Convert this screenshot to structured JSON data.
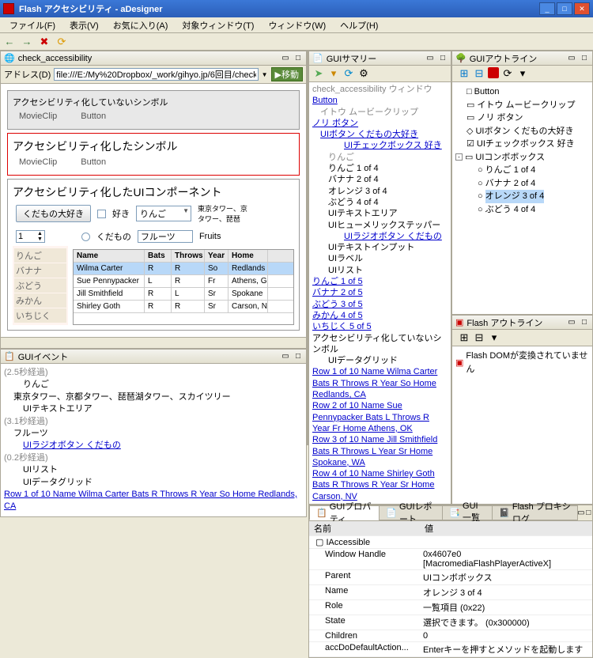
{
  "window": {
    "title": "Flash アクセシビリティ - aDesigner"
  },
  "menu": {
    "file": "ファイル(F)",
    "view": "表示(V)",
    "favorites": "お気に入り(A)",
    "targetWindow": "対象ウィンドウ(T)",
    "windows": "ウィンドウ(W)",
    "help": "ヘルプ(H)"
  },
  "toolbar": {
    "back": "←",
    "forward": "→",
    "stop": "✖",
    "refresh": "⟳"
  },
  "browser": {
    "panel_title": "check_accessibility",
    "address_label": "アドレス(D)",
    "url": "file:///E:/My%20Dropbox/_work/gihyo.jp/6回目/check_accessibility.html",
    "go_label": "移動"
  },
  "flash": {
    "box1_title": "アクセシビリティ化していないシンボル",
    "box2_title": "アクセシビリティ化したシンボル",
    "box3_title": "アクセシビリティ化したUIコンポーネント",
    "movieclip": "MovieClip",
    "button": "Button",
    "favorite_label": "くだもの大好き",
    "like_label": "好き",
    "combo_value": "りんご",
    "rhs_text": "東京タワー、京\nタワー、琵琶",
    "stepper_value": "1",
    "radio_label": "くだもの",
    "text_input": "フルーツ",
    "text_label": "Fruits",
    "side_items": [
      "りんご",
      "バナナ",
      "ぶどう",
      "みかん",
      "いちじく"
    ],
    "headers": [
      "Name",
      "Bats",
      "Throws",
      "Year",
      "Home"
    ],
    "rows": [
      [
        "Wilma Carter",
        "R",
        "R",
        "So",
        "Redlands"
      ],
      [
        "Sue Pennypacker",
        "L",
        "R",
        "Fr",
        "Athens, G"
      ],
      [
        "Jill Smithfield",
        "R",
        "L",
        "Sr",
        "Spokane"
      ],
      [
        "Shirley Goth",
        "R",
        "R",
        "Sr",
        "Carson, N"
      ]
    ]
  },
  "summary": {
    "title": "GUIサマリー",
    "root": "check_accessibility ウィンドウ",
    "items": [
      {
        "t": "Button",
        "link": true
      },
      {
        "t": "イトウ ムービークリップ",
        "gray": true,
        "indent": 1
      },
      {
        "t": "ノリ ボタン",
        "link": true
      },
      {
        "t": "UIボタン くだもの大好き",
        "link": true,
        "indent": 1
      },
      {
        "t": "UIチェックボックス 好き",
        "link": true,
        "indent": 4
      },
      {
        "t": "りんご",
        "gray": true,
        "indent": 2
      },
      {
        "t": "りんご 1 of 4",
        "indent": 2
      },
      {
        "t": "バナナ 2 of 4",
        "indent": 2
      },
      {
        "t": "オレンジ 3 of 4",
        "indent": 2
      },
      {
        "t": "ぶどう 4 of 4",
        "indent": 2
      },
      {
        "t": "UIテキストエリア",
        "indent": 2
      },
      {
        "t": "UIヒューメリックステッパー",
        "indent": 2
      },
      {
        "t": "UIラジオボタン くだもの",
        "link": true,
        "indent": 4
      },
      {
        "t": "UIテキストインプット",
        "indent": 2
      },
      {
        "t": "UIラベル",
        "indent": 2
      },
      {
        "t": "UIリスト",
        "indent": 2
      },
      {
        "t": "りんご 1 of 5",
        "link": true
      },
      {
        "t": "バナナ 2 of 5",
        "link": true
      },
      {
        "t": "ぶどう 3 of 5",
        "link": true
      },
      {
        "t": "みかん 4 of 5",
        "link": true
      },
      {
        "t": "いちじく 5 of 5",
        "link": true
      },
      {
        "t": "アクセシビリティ化していないシンボル"
      },
      {
        "t": "UIデータグリッド",
        "indent": 2
      },
      {
        "t": "Row 1 of 10 Name Wilma Carter Bats R Throws R Year So Home Redlands, CA",
        "link": true
      },
      {
        "t": "Row 2 of 10 Name Sue Pennypacker Bats L Throws R Year Fr Home Athens, OK",
        "link": true
      },
      {
        "t": "Row 3 of 10 Name Jill Smithfield Bats R Throws L Year Sr Home Spokane, WA",
        "link": true
      },
      {
        "t": "Row 4 of 10 Name Shirley Goth Bats R Throws R Year Sr Home Carson, NV",
        "link": true
      }
    ]
  },
  "outline": {
    "title": "GUIアウトライン",
    "items": [
      {
        "icon": "□",
        "label": "Button"
      },
      {
        "icon": "▭",
        "label": "イトウ ムービークリップ"
      },
      {
        "icon": "▭",
        "label": "ノリ ボタン"
      },
      {
        "icon": "◇",
        "label": "UIボタン くだもの大好き"
      },
      {
        "icon": "☑",
        "label": "UIチェックボックス 好き"
      },
      {
        "icon": "▭",
        "label": "UIコンボボックス",
        "expand": "-",
        "children": [
          {
            "icon": "○",
            "label": "りんご 1 of 4"
          },
          {
            "icon": "○",
            "label": "バナナ 2 of 4"
          },
          {
            "icon": "○",
            "label": "オレンジ 3 of 4",
            "sel": true
          },
          {
            "icon": "○",
            "label": "ぶどう 4 of 4"
          }
        ]
      }
    ]
  },
  "flash_outline": {
    "title": "Flash アウトライン",
    "msg": "Flash DOMが変換されていません"
  },
  "events": {
    "title": "GUIイベント",
    "lines": [
      {
        "t": "(2.5秒経過)",
        "gray": true
      },
      {
        "t": "りんご",
        "indent": 2
      },
      {
        "t": "東京タワー、京都タワー、琵琶湖タワー、スカイツリー",
        "indent": 1
      },
      {
        "t": "UIテキストエリア",
        "indent": 2
      },
      {
        "t": "(3.1秒経過)",
        "gray": true
      },
      {
        "t": "フルーツ",
        "indent": 1
      },
      {
        "t": "UIラジオボタン くだもの",
        "link": true,
        "indent": 2
      },
      {
        "t": "(0.2秒経過)",
        "gray": true
      },
      {
        "t": "UIリスト",
        "indent": 2
      },
      {
        "t": "UIデータグリッド",
        "indent": 2
      },
      {
        "t": "Row 1 of 10 Name Wilma Carter Bats R Throws R Year So Home Redlands, CA",
        "link": true
      }
    ]
  },
  "bottom_tabs": {
    "t1": "GUIプロパティ",
    "t2": "GUIレポート",
    "t3": "GUI一覧",
    "t4": "Flash プロキシ ログ"
  },
  "props": {
    "name_h": "名前",
    "value_h": "値",
    "root": "IAccessible",
    "rows": [
      [
        "Window Handle",
        "0x4607e0 [MacromediaFlashPlayerActiveX]"
      ],
      [
        "Parent",
        "UIコンボボックス"
      ],
      [
        "Name",
        "オレンジ 3 of 4"
      ],
      [
        "Role",
        "一覧項目 (0x22)"
      ],
      [
        "State",
        "選択できます。 (0x300000)"
      ],
      [
        "Children",
        "0"
      ],
      [
        "accDoDefaultAction...",
        "Enterキーを押すとメソッドを起動します"
      ]
    ]
  }
}
